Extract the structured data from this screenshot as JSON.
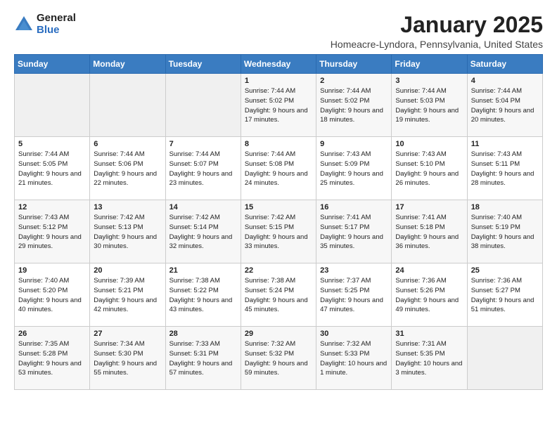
{
  "logo": {
    "general": "General",
    "blue": "Blue"
  },
  "title": "January 2025",
  "subtitle": "Homeacre-Lyndora, Pennsylvania, United States",
  "weekdays": [
    "Sunday",
    "Monday",
    "Tuesday",
    "Wednesday",
    "Thursday",
    "Friday",
    "Saturday"
  ],
  "weeks": [
    [
      {
        "day": null,
        "num": null,
        "info": null
      },
      {
        "day": null,
        "num": null,
        "info": null
      },
      {
        "day": null,
        "num": null,
        "info": null
      },
      {
        "num": "1",
        "info": "Sunrise: 7:44 AM\nSunset: 5:02 PM\nDaylight: 9 hours and 17 minutes."
      },
      {
        "num": "2",
        "info": "Sunrise: 7:44 AM\nSunset: 5:02 PM\nDaylight: 9 hours and 18 minutes."
      },
      {
        "num": "3",
        "info": "Sunrise: 7:44 AM\nSunset: 5:03 PM\nDaylight: 9 hours and 19 minutes."
      },
      {
        "num": "4",
        "info": "Sunrise: 7:44 AM\nSunset: 5:04 PM\nDaylight: 9 hours and 20 minutes."
      }
    ],
    [
      {
        "num": "5",
        "info": "Sunrise: 7:44 AM\nSunset: 5:05 PM\nDaylight: 9 hours and 21 minutes."
      },
      {
        "num": "6",
        "info": "Sunrise: 7:44 AM\nSunset: 5:06 PM\nDaylight: 9 hours and 22 minutes."
      },
      {
        "num": "7",
        "info": "Sunrise: 7:44 AM\nSunset: 5:07 PM\nDaylight: 9 hours and 23 minutes."
      },
      {
        "num": "8",
        "info": "Sunrise: 7:44 AM\nSunset: 5:08 PM\nDaylight: 9 hours and 24 minutes."
      },
      {
        "num": "9",
        "info": "Sunrise: 7:43 AM\nSunset: 5:09 PM\nDaylight: 9 hours and 25 minutes."
      },
      {
        "num": "10",
        "info": "Sunrise: 7:43 AM\nSunset: 5:10 PM\nDaylight: 9 hours and 26 minutes."
      },
      {
        "num": "11",
        "info": "Sunrise: 7:43 AM\nSunset: 5:11 PM\nDaylight: 9 hours and 28 minutes."
      }
    ],
    [
      {
        "num": "12",
        "info": "Sunrise: 7:43 AM\nSunset: 5:12 PM\nDaylight: 9 hours and 29 minutes."
      },
      {
        "num": "13",
        "info": "Sunrise: 7:42 AM\nSunset: 5:13 PM\nDaylight: 9 hours and 30 minutes."
      },
      {
        "num": "14",
        "info": "Sunrise: 7:42 AM\nSunset: 5:14 PM\nDaylight: 9 hours and 32 minutes."
      },
      {
        "num": "15",
        "info": "Sunrise: 7:42 AM\nSunset: 5:15 PM\nDaylight: 9 hours and 33 minutes."
      },
      {
        "num": "16",
        "info": "Sunrise: 7:41 AM\nSunset: 5:17 PM\nDaylight: 9 hours and 35 minutes."
      },
      {
        "num": "17",
        "info": "Sunrise: 7:41 AM\nSunset: 5:18 PM\nDaylight: 9 hours and 36 minutes."
      },
      {
        "num": "18",
        "info": "Sunrise: 7:40 AM\nSunset: 5:19 PM\nDaylight: 9 hours and 38 minutes."
      }
    ],
    [
      {
        "num": "19",
        "info": "Sunrise: 7:40 AM\nSunset: 5:20 PM\nDaylight: 9 hours and 40 minutes."
      },
      {
        "num": "20",
        "info": "Sunrise: 7:39 AM\nSunset: 5:21 PM\nDaylight: 9 hours and 42 minutes."
      },
      {
        "num": "21",
        "info": "Sunrise: 7:38 AM\nSunset: 5:22 PM\nDaylight: 9 hours and 43 minutes."
      },
      {
        "num": "22",
        "info": "Sunrise: 7:38 AM\nSunset: 5:24 PM\nDaylight: 9 hours and 45 minutes."
      },
      {
        "num": "23",
        "info": "Sunrise: 7:37 AM\nSunset: 5:25 PM\nDaylight: 9 hours and 47 minutes."
      },
      {
        "num": "24",
        "info": "Sunrise: 7:36 AM\nSunset: 5:26 PM\nDaylight: 9 hours and 49 minutes."
      },
      {
        "num": "25",
        "info": "Sunrise: 7:36 AM\nSunset: 5:27 PM\nDaylight: 9 hours and 51 minutes."
      }
    ],
    [
      {
        "num": "26",
        "info": "Sunrise: 7:35 AM\nSunset: 5:28 PM\nDaylight: 9 hours and 53 minutes."
      },
      {
        "num": "27",
        "info": "Sunrise: 7:34 AM\nSunset: 5:30 PM\nDaylight: 9 hours and 55 minutes."
      },
      {
        "num": "28",
        "info": "Sunrise: 7:33 AM\nSunset: 5:31 PM\nDaylight: 9 hours and 57 minutes."
      },
      {
        "num": "29",
        "info": "Sunrise: 7:32 AM\nSunset: 5:32 PM\nDaylight: 9 hours and 59 minutes."
      },
      {
        "num": "30",
        "info": "Sunrise: 7:32 AM\nSunset: 5:33 PM\nDaylight: 10 hours and 1 minute."
      },
      {
        "num": "31",
        "info": "Sunrise: 7:31 AM\nSunset: 5:35 PM\nDaylight: 10 hours and 3 minutes."
      },
      {
        "day": null,
        "num": null,
        "info": null
      }
    ]
  ]
}
